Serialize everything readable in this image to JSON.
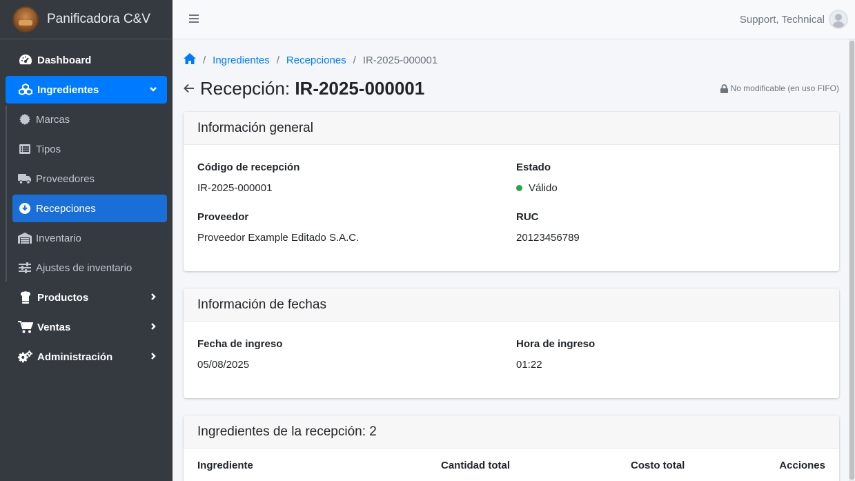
{
  "brand": {
    "name": "Panificadora C&V"
  },
  "sidebar": {
    "items": [
      {
        "label": "Dashboard",
        "icon": "dashboard-icon"
      },
      {
        "label": "Ingredientes",
        "icon": "cubes-icon",
        "expanded": true,
        "children": [
          {
            "label": "Marcas",
            "icon": "certificate-icon"
          },
          {
            "label": "Tipos",
            "icon": "list-icon"
          },
          {
            "label": "Proveedores",
            "icon": "truck-icon"
          },
          {
            "label": "Recepciones",
            "icon": "download-circle-icon",
            "active": true
          },
          {
            "label": "Inventario",
            "icon": "warehouse-icon"
          },
          {
            "label": "Ajustes de inventario",
            "icon": "sliders-icon"
          }
        ]
      },
      {
        "label": "Productos",
        "icon": "chef-hat-icon"
      },
      {
        "label": "Ventas",
        "icon": "cart-icon"
      },
      {
        "label": "Administración",
        "icon": "gears-icon"
      }
    ],
    "active_color": "#007bff"
  },
  "topbar": {
    "user_name": "Support, Technical"
  },
  "breadcrumb": {
    "items": [
      "Ingredientes",
      "Recepciones"
    ],
    "current": "IR-2025-000001"
  },
  "page": {
    "title_prefix": "Recepción:",
    "title_code": "IR-2025-000001",
    "lock_note": "No modificable (en uso FIFO)"
  },
  "general": {
    "header": "Información general",
    "code_label": "Código de recepción",
    "code_value": "IR-2025-000001",
    "status_label": "Estado",
    "status_value": "Válido",
    "status_color": "#28a745",
    "supplier_label": "Proveedor",
    "supplier_value": "Proveedor Example Editado S.A.C.",
    "ruc_label": "RUC",
    "ruc_value": "20123456789"
  },
  "dates": {
    "header": "Información de fechas",
    "date_label": "Fecha de ingreso",
    "date_value": "05/08/2025",
    "time_label": "Hora de ingreso",
    "time_value": "01:22"
  },
  "ingredients": {
    "header": "Ingredientes de la recepción: 2",
    "columns": [
      "Ingrediente",
      "Cantidad total",
      "Costo total",
      "Acciones"
    ]
  }
}
